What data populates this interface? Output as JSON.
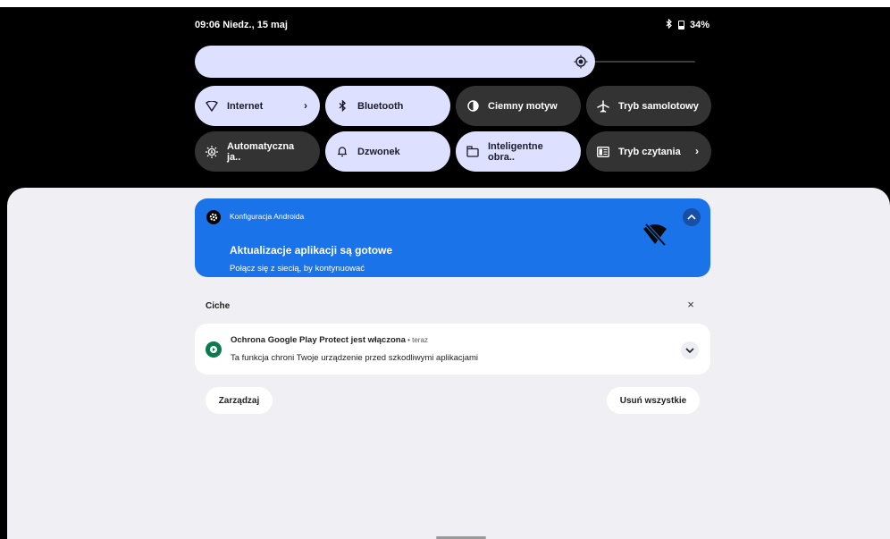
{
  "status_bar": {
    "datetime": "09:06 Niedz., 15 maj",
    "battery": "34%",
    "icons": [
      "bluetooth-icon",
      "battery-icon"
    ]
  },
  "brightness": {
    "level": 0.8
  },
  "tiles": [
    {
      "label": "Internet",
      "icon": "wifi-icon",
      "active": true,
      "chevron": "›"
    },
    {
      "label": "Bluetooth",
      "icon": "bluetooth-icon",
      "active": true
    },
    {
      "label": "Ciemny motyw",
      "icon": "dark-mode-icon",
      "active": false
    },
    {
      "label": "Tryb samolotowy",
      "icon": "airplane-icon",
      "active": false
    },
    {
      "label": "Automatyczna ja..",
      "icon": "auto-brightness-icon",
      "active": false
    },
    {
      "label": "Dzwonek",
      "icon": "bell-icon",
      "active": true
    },
    {
      "label": "Inteligentne obra..",
      "icon": "smart-rotate-icon",
      "active": true
    },
    {
      "label": "Tryb czytania",
      "icon": "reading-mode-icon",
      "active": false,
      "chevron": "›"
    }
  ],
  "notification_alert": {
    "app": "Konfiguracja Androida",
    "title": "Aktualizacje aplikacji są gotowe",
    "text": "Połącz się z siecią, by kontynuować",
    "color": "#1a73e8"
  },
  "silent": {
    "label": "Ciche",
    "close": "×",
    "notification": {
      "title": "Ochrona Google Play Protect jest włączona",
      "time": " • teraz",
      "text": "Ta funkcja chroni Twoje urządzenie przed szkodliwymi aplikacjami",
      "icon_color": "#0b7a50"
    }
  },
  "buttons": {
    "manage": "Zarządzaj",
    "clear_all": "Usuń wszystkie"
  }
}
